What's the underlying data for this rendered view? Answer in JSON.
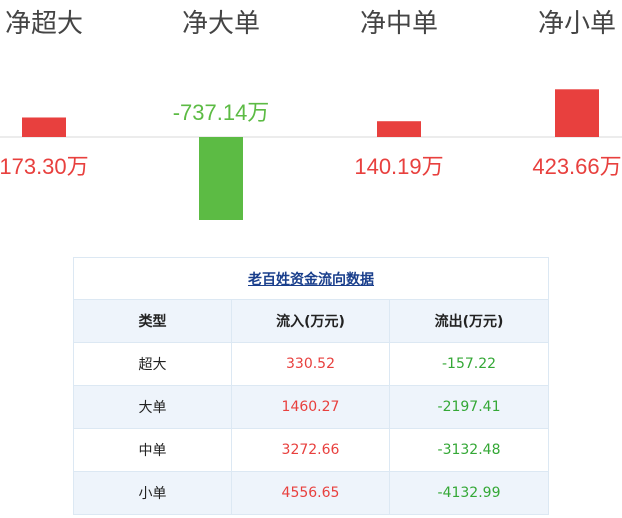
{
  "chart_data": {
    "type": "bar",
    "categories": [
      "净超大",
      "净大单",
      "净中单",
      "净小单"
    ],
    "values": [
      173.3,
      -737.14,
      140.19,
      423.66
    ],
    "value_labels": [
      "173.30万",
      "-737.14万",
      "140.19万",
      "423.66万"
    ],
    "unit": "万",
    "colors": {
      "positive": "#e8403e",
      "negative": "#5cbb44",
      "axis": "#d9d9d9",
      "category_text": "#444444"
    }
  },
  "table": {
    "title": "老百姓资金流向数据",
    "headers": [
      "类型",
      "流入(万元)",
      "流出(万元)"
    ],
    "rows": [
      {
        "type": "超大",
        "in": "330.52",
        "out": "-157.22"
      },
      {
        "type": "大单",
        "in": "1460.27",
        "out": "-2197.41"
      },
      {
        "type": "中单",
        "in": "3272.66",
        "out": "-3132.48"
      },
      {
        "type": "小单",
        "in": "4556.65",
        "out": "-4132.99"
      }
    ]
  }
}
